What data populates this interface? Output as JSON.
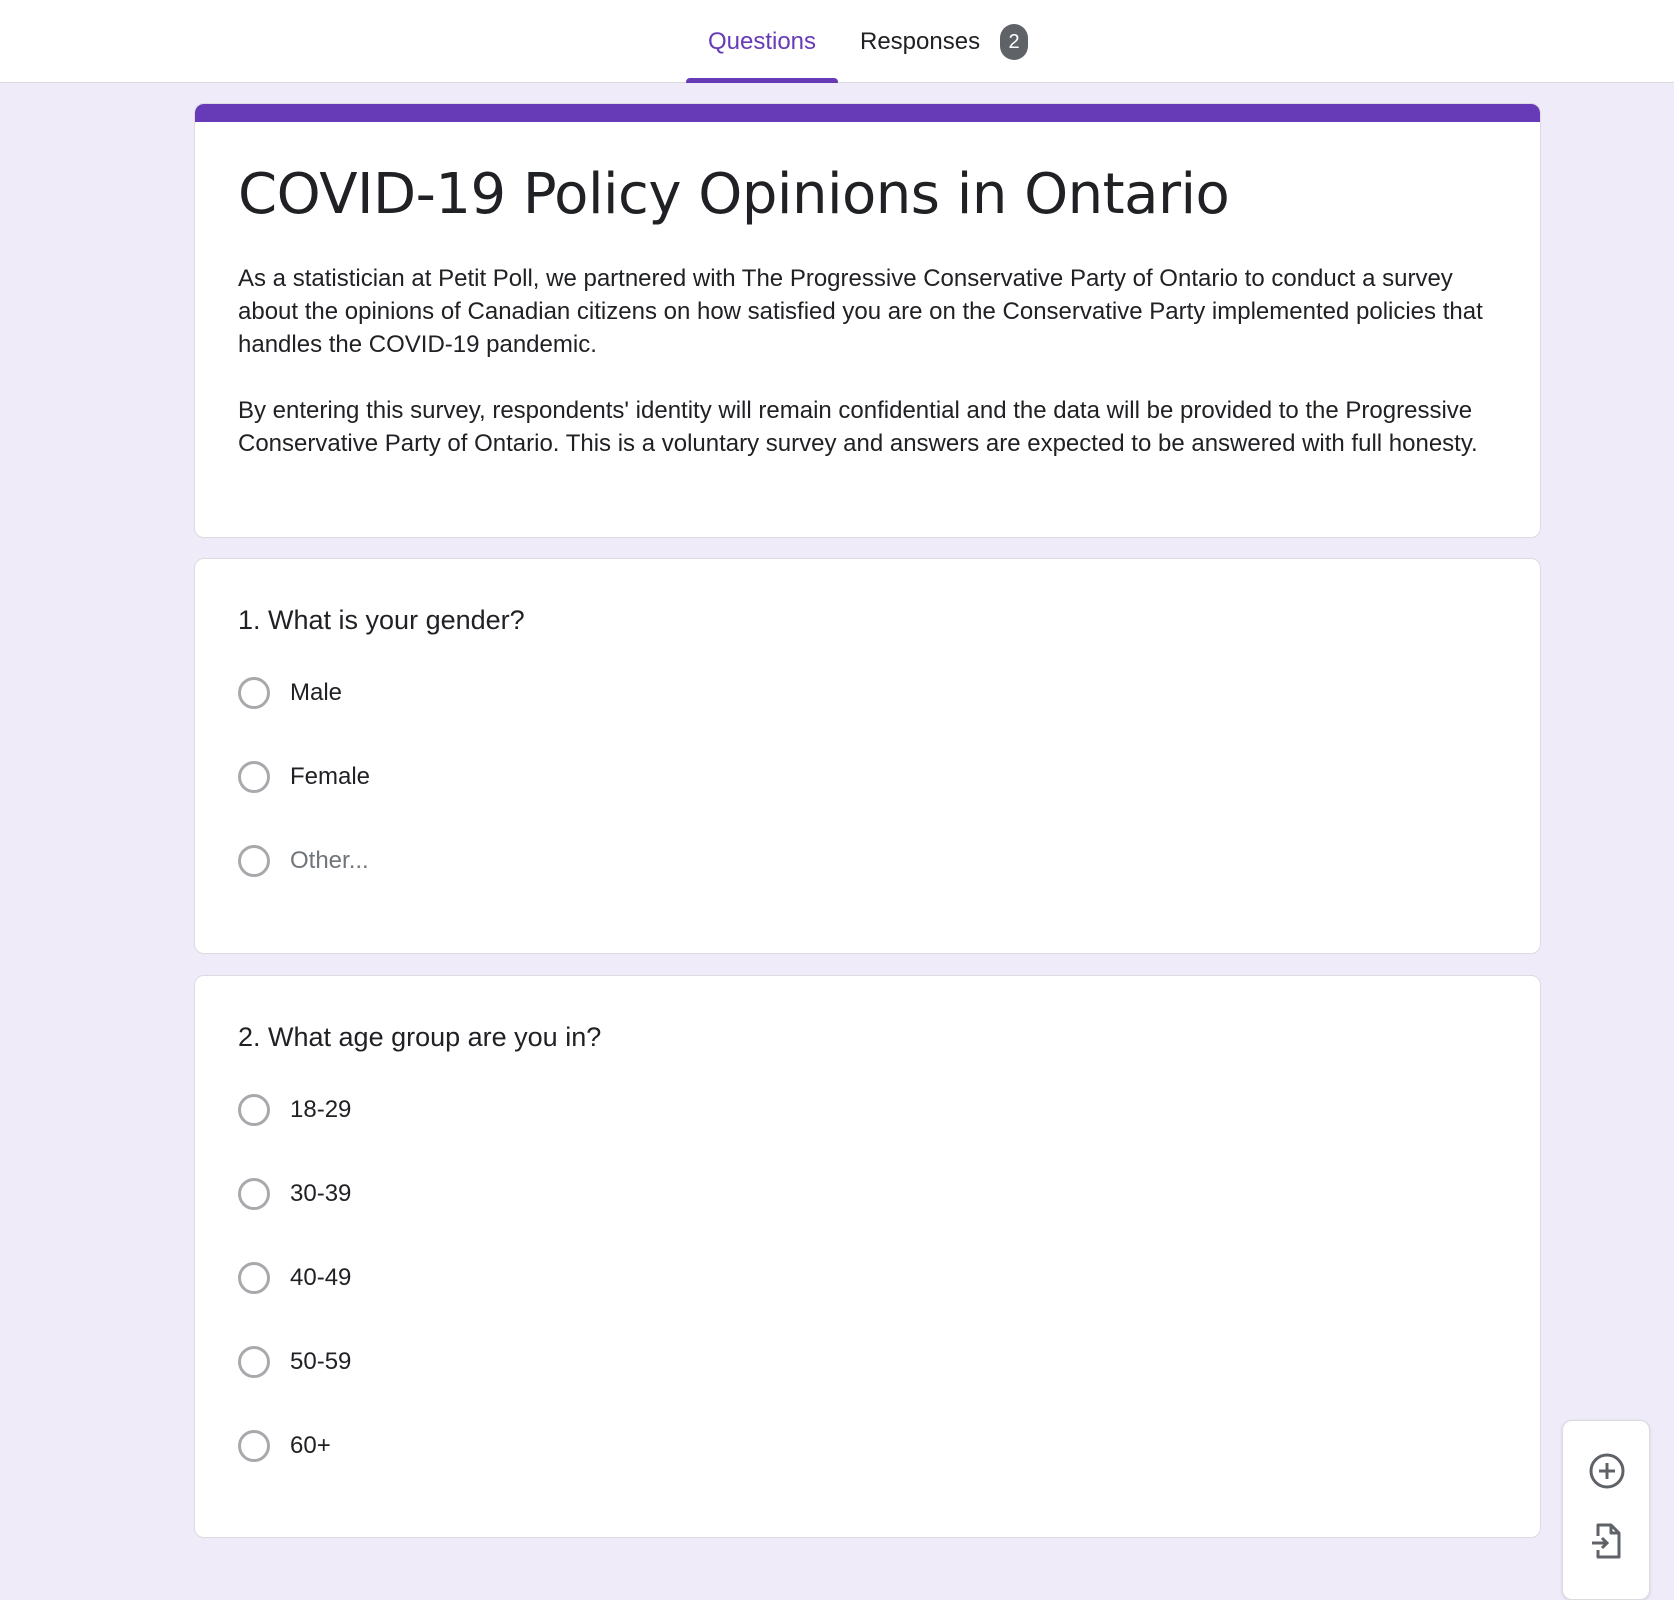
{
  "header": {
    "tabs": [
      {
        "label": "Questions",
        "active": true
      },
      {
        "label": "Responses",
        "active": false,
        "badge": "2"
      }
    ]
  },
  "form": {
    "title": "COVID-19 Policy Opinions in Ontario",
    "description": [
      "As a statistician at Petit Poll, we partnered with The Progressive Conservative Party of Ontario to conduct a survey about the opinions of Canadian citizens on how satisfied you are on the Conservative Party implemented policies that handles the COVID-19 pandemic.",
      "By entering this survey, respondents' identity will remain confidential and the data will be provided to the Progressive Conservative Party of Ontario. This is a voluntary survey and answers are expected to be answered with full honesty."
    ],
    "accent_color": "#673ab7"
  },
  "questions": [
    {
      "title": "1. What is your gender?",
      "options": [
        "Male",
        "Female",
        "Other..."
      ]
    },
    {
      "title": "2. What age group are you in?",
      "options": [
        "18-29",
        "30-39",
        "40-49",
        "50-59",
        "60+"
      ]
    }
  ],
  "toolbar": {
    "icons": [
      "add-question-icon",
      "import-questions-icon"
    ]
  },
  "colors": {
    "background": "#f0ebf8",
    "accent": "#673ab7",
    "badge": "#5f6368"
  }
}
